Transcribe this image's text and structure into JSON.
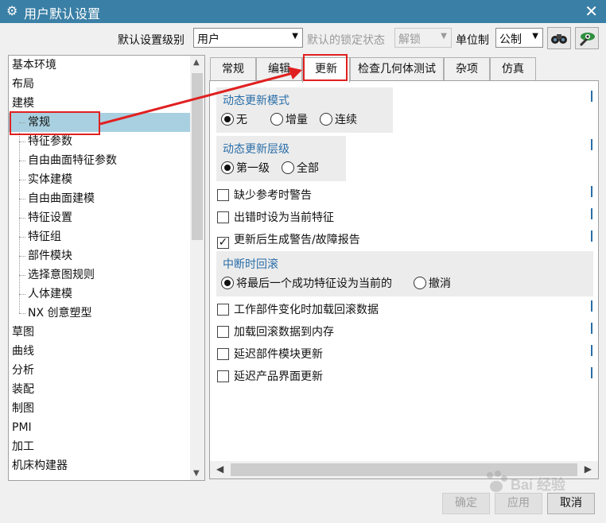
{
  "window": {
    "title": "用户默认设置"
  },
  "toolbar": {
    "level_label": "默认设置级别",
    "level_value": "用户",
    "lock_label": "默认的锁定状态",
    "lock_value": "解锁",
    "unit_label": "单位制",
    "unit_value": "公制"
  },
  "tree": {
    "items": [
      {
        "label": "基本环境"
      },
      {
        "label": "布局"
      },
      {
        "label": "建模"
      },
      {
        "label": "常规"
      },
      {
        "label": "特征参数"
      },
      {
        "label": "自由曲面特征参数"
      },
      {
        "label": "实体建模"
      },
      {
        "label": "自由曲面建模"
      },
      {
        "label": "特征设置"
      },
      {
        "label": "特征组"
      },
      {
        "label": "部件模块"
      },
      {
        "label": "选择意图规则"
      },
      {
        "label": "人体建模"
      },
      {
        "label": "NX 创意塑型"
      },
      {
        "label": "草图"
      },
      {
        "label": "曲线"
      },
      {
        "label": "分析"
      },
      {
        "label": "装配"
      },
      {
        "label": "制图"
      },
      {
        "label": "PMI"
      },
      {
        "label": "加工"
      },
      {
        "label": "机床构建器"
      }
    ]
  },
  "tabs": [
    {
      "label": "常规"
    },
    {
      "label": "编辑"
    },
    {
      "label": "更新"
    },
    {
      "label": "检查几何体测试"
    },
    {
      "label": "杂项"
    },
    {
      "label": "仿真"
    }
  ],
  "panel": {
    "dyn_mode": {
      "title": "动态更新模式",
      "options": [
        "无",
        "增量",
        "连续"
      ],
      "selected": "无"
    },
    "dyn_level": {
      "title": "动态更新层级",
      "options": [
        "第一级",
        "全部"
      ],
      "selected": "第一级"
    },
    "checks1": [
      {
        "label": "缺少参考时警告",
        "checked": false
      },
      {
        "label": "出错时设为当前特征",
        "checked": false
      },
      {
        "label": "更新后生成警告/故障报告",
        "checked": true
      }
    ],
    "rollback": {
      "title": "中断时回滚",
      "options": [
        "将最后一个成功特征设为当前的",
        "撤消"
      ],
      "selected": "将最后一个成功特征设为当前的"
    },
    "checks2": [
      {
        "label": "工作部件变化时加载回滚数据",
        "checked": false
      },
      {
        "label": "加载回滚数据到内存",
        "checked": false
      },
      {
        "label": "延迟部件模块更新",
        "checked": false
      },
      {
        "label": "延迟产品界面更新",
        "checked": false
      }
    ]
  },
  "buttons": {
    "ok": "确定",
    "apply": "应用",
    "cancel": "取消"
  },
  "watermark": {
    "text": "Bai 经验"
  },
  "colors": {
    "titlebar": "#3a7fa5",
    "selection": "#a8d0e0",
    "group_title": "#2a6ea8",
    "annotation": "#e02020"
  }
}
